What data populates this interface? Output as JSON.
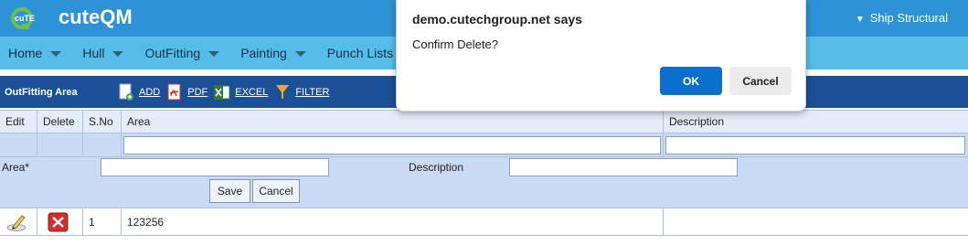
{
  "header": {
    "brand": "cuteQM",
    "logo_text": "cuTE",
    "user_menu": "Ship Structural"
  },
  "nav": {
    "items": [
      {
        "label": "Home"
      },
      {
        "label": "Hull"
      },
      {
        "label": "OutFitting"
      },
      {
        "label": "Painting"
      },
      {
        "label": "Punch Lists"
      }
    ]
  },
  "toolbar": {
    "title": "OutFitting Area",
    "add": "ADD",
    "pdf": "PDF",
    "excel": "EXCEL",
    "filter": "FILTER"
  },
  "grid": {
    "columns": [
      "Edit",
      "Delete",
      "S.No",
      "Area",
      "Description"
    ],
    "rows": [
      {
        "sno": "1",
        "area": "123256",
        "description": ""
      }
    ]
  },
  "form": {
    "area_label": "Area*",
    "area_value": "",
    "description_label": "Description",
    "description_value": "",
    "save": "Save",
    "cancel": "Cancel"
  },
  "dialog": {
    "title": "demo.cutechgroup.net says",
    "message": "Confirm Delete?",
    "ok": "OK",
    "cancel": "Cancel"
  },
  "colors": {
    "header": "#2d93d6",
    "nav": "#56bde9",
    "toolbar": "#1b4f96",
    "grid_header": "#e3ecf8",
    "grid_filter": "#c9dbf2",
    "dialog_ok": "#0b6fcb"
  }
}
